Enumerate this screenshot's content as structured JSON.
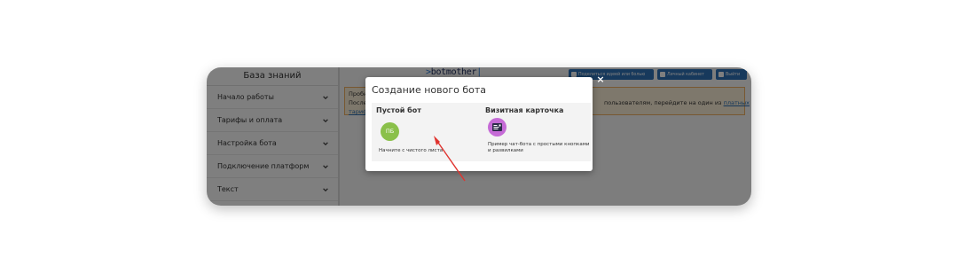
{
  "sidebar": {
    "title": "База знаний",
    "items": [
      {
        "label": "Начало работы"
      },
      {
        "label": "Тарифы и оплата"
      },
      {
        "label": "Настройка бота"
      },
      {
        "label": "Подключение платформ"
      },
      {
        "label": "Текст"
      }
    ]
  },
  "header": {
    "logo_prefix": ">",
    "logo_text": "botmother",
    "logo_suffix": "|",
    "share_label": "Поделиться идеей или болью",
    "cabinet_label": "Личный кабинет",
    "logout_label": "Выйти",
    "button_color": "#2f73b9"
  },
  "notice": {
    "line1": "Пробн",
    "line2": "После",
    "tail_text": "пользователям, перейдите на один из",
    "link_text": "платных",
    "line3": "тариф"
  },
  "modal": {
    "title": "Создание нового бота",
    "close_label": "×",
    "cards": [
      {
        "title": "Пустой бот",
        "badge": "ПБ",
        "badge_color": "#8ac04a",
        "description": "Начните с чистого листа"
      },
      {
        "title": "Визитная карточка",
        "badge_color": "#c56bd6",
        "icon": "business-card-icon",
        "description_line1": "Пример чат-бота с простыми кнопками",
        "description_line2": "и развилками"
      }
    ]
  },
  "annotation": {
    "arrow_color": "#e0342f"
  }
}
